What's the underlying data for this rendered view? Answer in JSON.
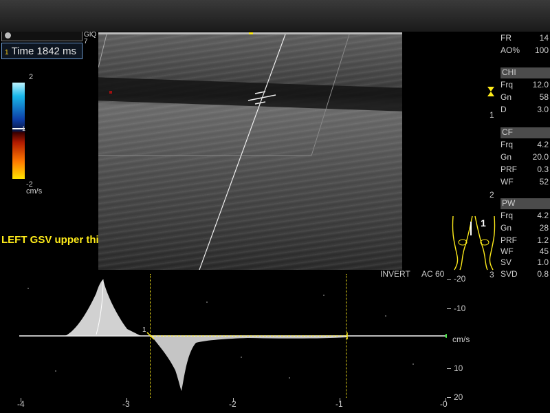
{
  "header": {
    "probe_label": "GIQ",
    "probe_sub": "7",
    "cursor_index": "1",
    "time_label": "Time 1842 ms"
  },
  "color_scale": {
    "top_value": "2",
    "mid_value": "1",
    "bottom_value": "-2",
    "unit": "cm/s",
    "colors": {
      "high": "#bff4ff",
      "mid_blue": "#0d3fa8",
      "mid_red": "#b01a00",
      "low": "#ffe400"
    }
  },
  "location_label": "LEFT GSV upper thigh",
  "params": {
    "fr_label": "FR",
    "fr_value": "14",
    "ao_label": "AO%",
    "ao_value": "100",
    "chi": {
      "header": "CHI",
      "frq_label": "Frq",
      "frq_value": "12.0",
      "gn_label": "Gn",
      "gn_value": "58",
      "d_label": "D",
      "d_value": "3.0"
    },
    "cf": {
      "header": "CF",
      "frq_label": "Frq",
      "frq_value": "4.2",
      "gn_label": "Gn",
      "gn_value": "20.0",
      "prf_label": "PRF",
      "prf_value": "0.3",
      "wf_label": "WF",
      "wf_value": "52"
    },
    "pw": {
      "header": "PW",
      "frq_label": "Frq",
      "frq_value": "4.2",
      "gn_label": "Gn",
      "gn_value": "28",
      "prf_label": "PRF",
      "prf_value": "1.2",
      "wf_label": "WF",
      "wf_value": "45",
      "sv_label": "SV",
      "sv_value": "1.0",
      "svd_label": "SVD",
      "svd_value": "0.8"
    }
  },
  "depth_marks": [
    "1",
    "2",
    "3"
  ],
  "body_marker_label": "1",
  "spectral": {
    "invert_label": "INVERT",
    "ac_label": "AC 60",
    "unit": "cm/s",
    "cursor_label": "1",
    "y_ticks": [
      "-20",
      "-10",
      "10",
      "20"
    ],
    "x_ticks": [
      "-4",
      "-3",
      "-2",
      "-1",
      "-0"
    ]
  }
}
